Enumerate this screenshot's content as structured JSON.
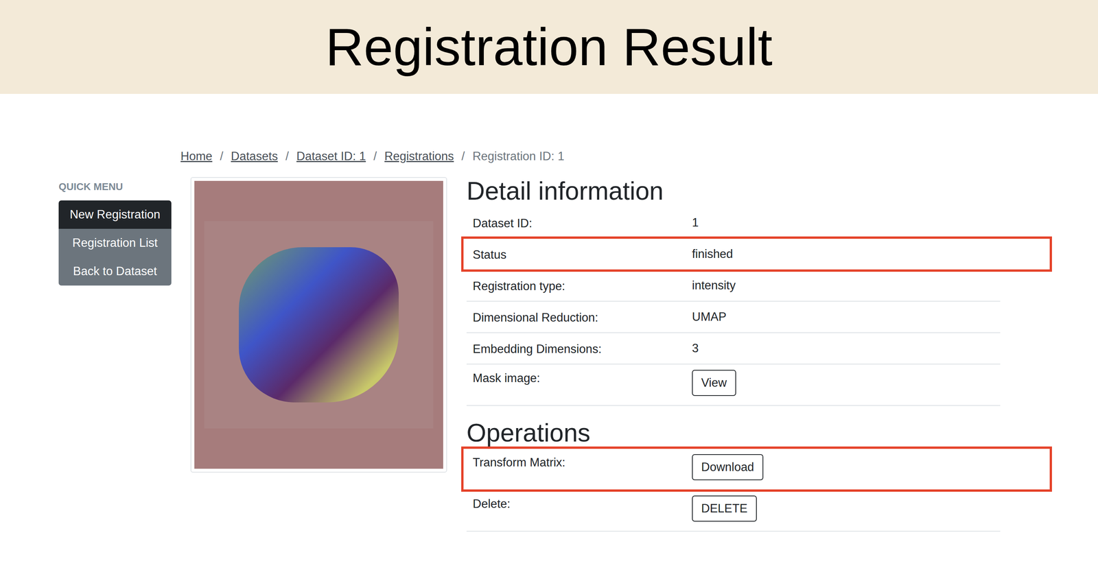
{
  "header": {
    "title": "Registration Result"
  },
  "breadcrumb": {
    "separator": "/",
    "items": [
      {
        "label": "Home",
        "current": false
      },
      {
        "label": "Datasets",
        "current": false
      },
      {
        "label": "Dataset ID: 1",
        "current": false
      },
      {
        "label": "Registrations",
        "current": false
      },
      {
        "label": "Registration ID: 1",
        "current": true
      }
    ]
  },
  "quick_menu": {
    "title": "QUICK MENU",
    "items": [
      {
        "label": "New Registration",
        "selected": true
      },
      {
        "label": "Registration List",
        "selected": false
      },
      {
        "label": "Back to Dataset",
        "selected": false
      }
    ]
  },
  "detail": {
    "heading": "Detail information",
    "rows": [
      {
        "label": "Dataset ID:",
        "kind": "text",
        "value": "1",
        "highlighted": false
      },
      {
        "label": "Status",
        "kind": "text",
        "value": "finished",
        "highlighted": true
      },
      {
        "label": "Registration type:",
        "kind": "text",
        "value": "intensity",
        "highlighted": false
      },
      {
        "label": "Dimensional Reduction:",
        "kind": "text",
        "value": "UMAP",
        "highlighted": false
      },
      {
        "label": "Embedding Dimensions:",
        "kind": "text",
        "value": "3",
        "highlighted": false
      },
      {
        "label": "Mask image:",
        "kind": "button",
        "value": "View",
        "highlighted": false
      }
    ]
  },
  "operations": {
    "heading": "Operations",
    "rows": [
      {
        "label": "Transform Matrix:",
        "kind": "button",
        "value": "Download",
        "highlighted": true
      },
      {
        "label": "Delete:",
        "kind": "button",
        "value": "DELETE",
        "highlighted": false
      }
    ]
  }
}
